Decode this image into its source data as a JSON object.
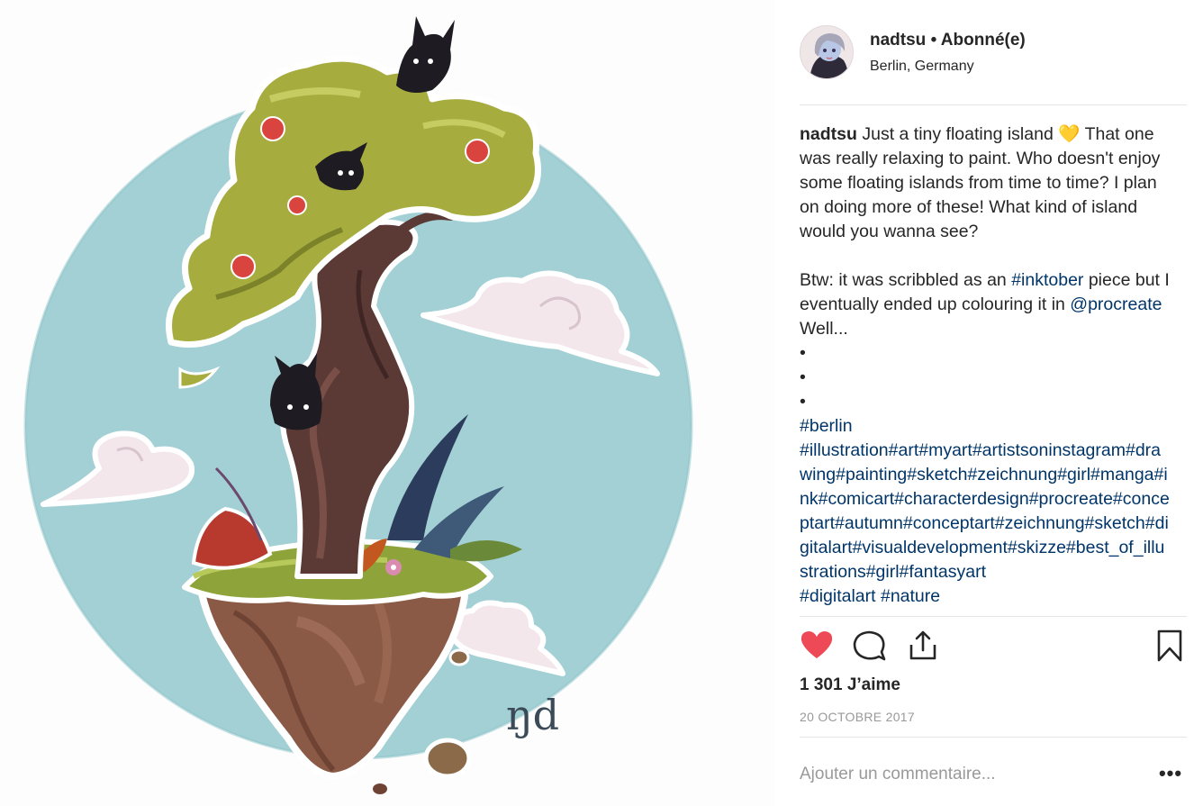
{
  "post": {
    "artwork_alt": "Illustration d'une île flottante avec un arbre",
    "signature": "ŋd"
  },
  "header": {
    "username": "nadtsu",
    "separator": "•",
    "follow_status": "Abonné(e)",
    "location": "Berlin, Germany"
  },
  "caption": {
    "username": "nadtsu",
    "text_1": "Just a tiny floating island",
    "emoji": "💛",
    "text_2": "That one was really relaxing to paint. Who doesn't enjoy some floating islands from time to time? I plan on doing more of these! What kind of island would you wanna see?",
    "text_3a": "Btw: it was scribbled as an",
    "hashtag_inktober": "#inktober",
    "text_3b": "piece but I eventually ended up colouring it in",
    "mention": "@procreate",
    "text_3c": "Well...",
    "bullets": [
      "•",
      "•",
      "•"
    ],
    "hashtag_berlin": "#berlin",
    "hashtags_block": "#illustration#art#myart#artistsoninstagram#drawing#painting#sketch#zeichnung#girl#manga#ink#comicart#characterdesign#procreate#conceptart#autumn#conceptart#zeichnung#sketch#digitalart#visualdevelopment#skizze#best_of_illustrations#girl#fantasyart",
    "hashtag_digitalart": "#digitalart",
    "hashtag_nature": "#nature"
  },
  "stats": {
    "likes": "1 301 J’aime",
    "date": "20 OCTOBRE 2017"
  },
  "comment": {
    "placeholder": "Ajouter un commentaire..."
  },
  "more_label": "•••",
  "colors": {
    "like_red": "#ed4956",
    "link_blue": "#003569",
    "sky_blue": "#9fcfd3",
    "foliage": "#a6ad3e",
    "trunk": "#5b3a36"
  }
}
